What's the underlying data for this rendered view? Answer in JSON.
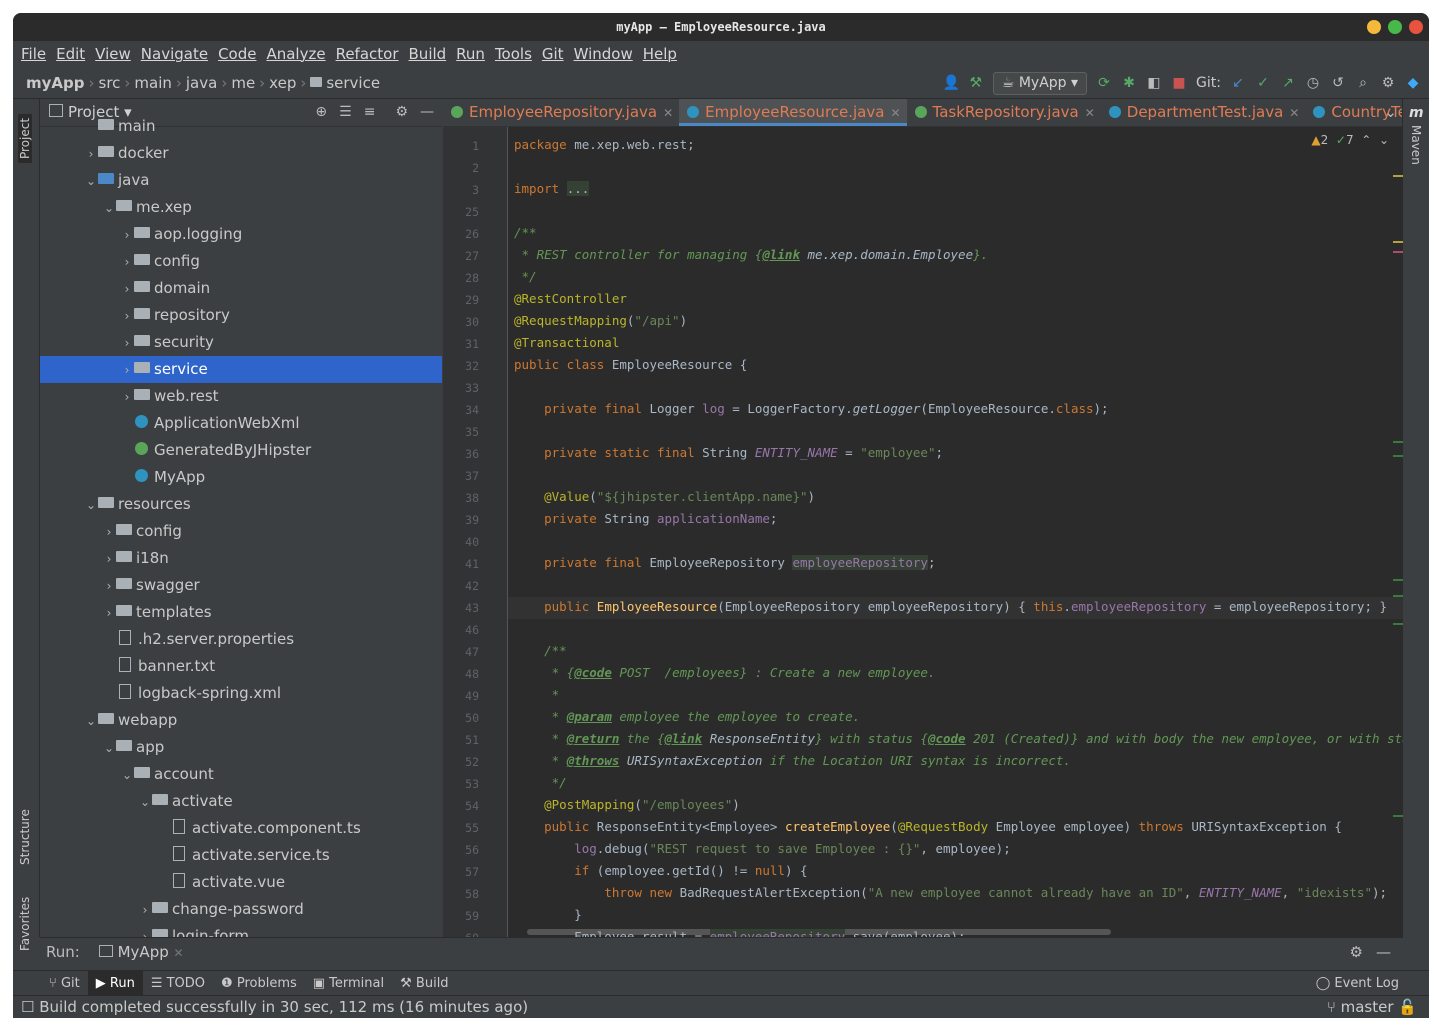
{
  "window": {
    "title": "myApp – EmployeeResource.java"
  },
  "menu": [
    "File",
    "Edit",
    "View",
    "Navigate",
    "Code",
    "Analyze",
    "Refactor",
    "Build",
    "Run",
    "Tools",
    "Git",
    "Window",
    "Help"
  ],
  "breadcrumb": [
    "myApp",
    "src",
    "main",
    "java",
    "me",
    "xep",
    "service"
  ],
  "toolbar": {
    "run_config": "MyApp",
    "git_label": "Git:"
  },
  "left_strip": {
    "project": "Project",
    "structure": "Structure",
    "favorites": "Favorites"
  },
  "right_strip": {
    "maven": "Maven"
  },
  "project_panel": {
    "title": "Project",
    "tree": [
      {
        "label": "main",
        "depth": 1,
        "kind": "folder",
        "arrow": "",
        "partial": true
      },
      {
        "label": "docker",
        "depth": 1,
        "kind": "folder",
        "arrow": "›"
      },
      {
        "label": "java",
        "depth": 1,
        "kind": "folder",
        "arrow": "⌄",
        "color": "#4a88c7"
      },
      {
        "label": "me.xep",
        "depth": 2,
        "kind": "folder",
        "arrow": "⌄"
      },
      {
        "label": "aop.logging",
        "depth": 3,
        "kind": "folder",
        "arrow": "›"
      },
      {
        "label": "config",
        "depth": 3,
        "kind": "folder",
        "arrow": "›"
      },
      {
        "label": "domain",
        "depth": 3,
        "kind": "folder",
        "arrow": "›"
      },
      {
        "label": "repository",
        "depth": 3,
        "kind": "folder",
        "arrow": "›"
      },
      {
        "label": "security",
        "depth": 3,
        "kind": "folder",
        "arrow": "›"
      },
      {
        "label": "service",
        "depth": 3,
        "kind": "folder",
        "arrow": "›",
        "selected": true
      },
      {
        "label": "web.rest",
        "depth": 3,
        "kind": "folder",
        "arrow": "›"
      },
      {
        "label": "ApplicationWebXml",
        "depth": 3,
        "kind": "class",
        "arrow": ""
      },
      {
        "label": "GeneratedByJHipster",
        "depth": 3,
        "kind": "class",
        "arrow": "",
        "color": "#5aa55a"
      },
      {
        "label": "MyApp",
        "depth": 3,
        "kind": "class",
        "arrow": ""
      },
      {
        "label": "resources",
        "depth": 1,
        "kind": "folder",
        "arrow": "⌄"
      },
      {
        "label": "config",
        "depth": 2,
        "kind": "folder",
        "arrow": "›"
      },
      {
        "label": "i18n",
        "depth": 2,
        "kind": "folder",
        "arrow": "›"
      },
      {
        "label": "swagger",
        "depth": 2,
        "kind": "folder",
        "arrow": "›"
      },
      {
        "label": "templates",
        "depth": 2,
        "kind": "folder",
        "arrow": "›"
      },
      {
        "label": ".h2.server.properties",
        "depth": 2,
        "kind": "file",
        "arrow": ""
      },
      {
        "label": "banner.txt",
        "depth": 2,
        "kind": "file",
        "arrow": ""
      },
      {
        "label": "logback-spring.xml",
        "depth": 2,
        "kind": "file",
        "arrow": ""
      },
      {
        "label": "webapp",
        "depth": 1,
        "kind": "folder",
        "arrow": "⌄"
      },
      {
        "label": "app",
        "depth": 2,
        "kind": "folder",
        "arrow": "⌄"
      },
      {
        "label": "account",
        "depth": 3,
        "kind": "folder",
        "arrow": "⌄"
      },
      {
        "label": "activate",
        "depth": 4,
        "kind": "folder",
        "arrow": "⌄"
      },
      {
        "label": "activate.component.ts",
        "depth": 5,
        "kind": "file",
        "arrow": ""
      },
      {
        "label": "activate.service.ts",
        "depth": 5,
        "kind": "file",
        "arrow": ""
      },
      {
        "label": "activate.vue",
        "depth": 5,
        "kind": "file",
        "arrow": ""
      },
      {
        "label": "change-password",
        "depth": 4,
        "kind": "folder",
        "arrow": "›"
      },
      {
        "label": "login-form",
        "depth": 4,
        "kind": "folder",
        "arrow": "›"
      }
    ]
  },
  "editor_tabs": [
    {
      "label": "EmployeeRepository.java",
      "icon_color": "#5aa55a"
    },
    {
      "label": "EmployeeResource.java",
      "icon_color": "#2f93bf",
      "active": true
    },
    {
      "label": "TaskRepository.java",
      "icon_color": "#5aa55a"
    },
    {
      "label": "DepartmentTest.java",
      "icon_color": "#2f93bf"
    },
    {
      "label": "CountryTest.ja",
      "icon_color": "#2f93bf"
    }
  ],
  "inspections": {
    "warnings": "2",
    "ok": "7"
  },
  "code_lines": [
    {
      "n": "1",
      "html": "<span class='kw'>package</span> me.xep.web.rest;"
    },
    {
      "n": "2",
      "html": ""
    },
    {
      "n": "3",
      "html": "<span class='kw'>import</span> <span class='hl'>...</span>"
    },
    {
      "n": "25",
      "html": ""
    },
    {
      "n": "26",
      "html": "<span class='cm'>/**</span>"
    },
    {
      "n": "27",
      "html": "<span class='cm'> * REST controller for managing {<span class='tag'>@link</span> <span style='color:#a9b7c6'>me.xep.domain.Employee</span>}.</span>"
    },
    {
      "n": "28",
      "html": "<span class='cm'> */</span>"
    },
    {
      "n": "29",
      "html": "<span class='ann'>@RestController</span>"
    },
    {
      "n": "30",
      "html": "<span class='ann'>@RequestMapping</span>(<span class='str'>\"/api\"</span>)"
    },
    {
      "n": "31",
      "html": "<span class='ann'>@Transactional</span>"
    },
    {
      "n": "32",
      "html": "<span class='kw'>public class</span> EmployeeResource {"
    },
    {
      "n": "33",
      "html": ""
    },
    {
      "n": "34",
      "html": "    <span class='kw'>private final</span> Logger <span class='fld'>log</span> = LoggerFactory.<span class='ital'>getLogger</span>(EmployeeResource.<span class='kw'>class</span>);"
    },
    {
      "n": "35",
      "html": ""
    },
    {
      "n": "36",
      "html": "    <span class='kw'>private static final</span> String <span class='fld ital'>ENTITY_NAME</span> = <span class='str'>\"employee\"</span>;"
    },
    {
      "n": "37",
      "html": ""
    },
    {
      "n": "38",
      "html": "    <span class='ann'>@Value</span>(<span class='str'>\"${jhipster.clientApp.name}\"</span>)"
    },
    {
      "n": "39",
      "html": "    <span class='kw'>private</span> String <span class='fld'>applicationName</span>;"
    },
    {
      "n": "40",
      "html": ""
    },
    {
      "n": "41",
      "html": "    <span class='kw'>private final</span> EmployeeRepository <span class='fld hl'>employeeRepository</span>;"
    },
    {
      "n": "42",
      "html": ""
    },
    {
      "n": "43",
      "html": "    <span class='kw'>public</span> <span style='color:#ffc66d'>EmployeeResource</span>(EmployeeRepository employeeRepository) { <span class='kw'>this</span>.<span class='fld'>employeeRepository</span> = employeeRepository; }",
      "current": true
    },
    {
      "n": "46",
      "html": ""
    },
    {
      "n": "47",
      "html": "    <span class='cm'>/**</span>"
    },
    {
      "n": "48",
      "html": "<span class='cm'>     * {<span class='tag'>@code</span> POST  /employees} : Create a new employee.</span>"
    },
    {
      "n": "49",
      "html": "<span class='cm'>     *</span>"
    },
    {
      "n": "50",
      "html": "<span class='cm'>     * <span class='tag'>@param</span> employee the employee to create.</span>"
    },
    {
      "n": "51",
      "html": "<span class='cm'>     * <span class='tag'>@return</span> the {<span class='tag'>@link</span> <span style='color:#a9b7c6'>ResponseEntity</span>} with status {<span class='tag'>@code</span> 201 (Created)} and with body the new employee, or with status {<span class='tag'>@co</span></span>"
    },
    {
      "n": "52",
      "html": "<span class='cm'>     * <span class='tag'>@throws</span> <span style='color:#a9b7c6'>URISyntaxException</span> if the Location URI syntax is incorrect.</span>"
    },
    {
      "n": "53",
      "html": "<span class='cm'>     */</span>"
    },
    {
      "n": "54",
      "html": "    <span class='ann'>@PostMapping</span>(<span class='str'>\"/employees\"</span>)"
    },
    {
      "n": "55",
      "html": "    <span class='kw'>public</span> ResponseEntity&lt;Employee&gt; <span style='color:#ffc66d'>createEmployee</span>(<span class='ann'>@RequestBody</span> Employee employee) <span class='kw'>throws</span> URISyntaxException {"
    },
    {
      "n": "56",
      "html": "        <span class='fld'>log</span>.debug(<span class='str'>\"REST request to save Employee : {}\"</span>, employee);"
    },
    {
      "n": "57",
      "html": "        <span class='kw'>if</span> (employee.getId() != <span class='kw'>null</span>) {"
    },
    {
      "n": "58",
      "html": "            <span class='kw'>throw new</span> BadRequestAlertException(<span class='str'>\"A new employee cannot already have an ID\"</span>, <span class='fld ital'>ENTITY_NAME</span>, <span class='str'>\"idexists\"</span>);"
    },
    {
      "n": "59",
      "html": "        }"
    },
    {
      "n": "60",
      "html": "        Employee result = <span class='fld hl'>employeeRepository</span>.save(employee);"
    }
  ],
  "run_bar": {
    "label": "Run:",
    "config": "MyApp"
  },
  "bottom_tabs": [
    {
      "label": "Git",
      "icon": "git-icon",
      "glyph": "⑂"
    },
    {
      "label": "Run",
      "icon": "run-icon",
      "glyph": "▶",
      "active": true
    },
    {
      "label": "TODO",
      "icon": "list-icon",
      "glyph": "☰"
    },
    {
      "label": "Problems",
      "icon": "problems-icon",
      "glyph": "❶"
    },
    {
      "label": "Terminal",
      "icon": "terminal-icon",
      "glyph": "▣"
    },
    {
      "label": "Build",
      "icon": "hammer-icon",
      "glyph": "⚒"
    }
  ],
  "event_log": "Event Log",
  "status": {
    "message": "Build completed successfully in 30 sec, 112 ms (16 minutes ago)",
    "branch": "master"
  }
}
